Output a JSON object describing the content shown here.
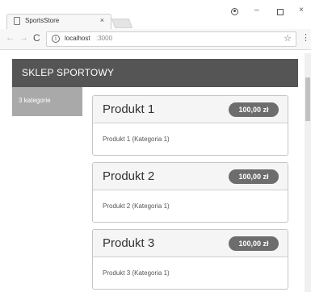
{
  "browser": {
    "tab_title": "SportsStore",
    "tab_close": "×",
    "url_host": "localhost",
    "url_port": ":3000",
    "window_min": "–",
    "window_close": "×",
    "back_glyph": "←",
    "forward_glyph": "→",
    "reload_glyph": "C",
    "info_glyph": "i",
    "star_glyph": "☆",
    "menu_glyph": "⋮"
  },
  "navbar": {
    "brand": "SKLEP SPORTOWY"
  },
  "categories": {
    "button_label": "3 kategorie"
  },
  "products": [
    {
      "name": "Produkt 1",
      "price": "100,00 zł",
      "description": "Produkt 1 (Kategoria 1)"
    },
    {
      "name": "Produkt 2",
      "price": "100,00 zł",
      "description": "Produkt 2 (Kategoria 1)"
    },
    {
      "name": "Produkt 3",
      "price": "100,00 zł",
      "description": "Produkt 3 (Kategoria 1)"
    }
  ],
  "colors": {
    "navbar_bg": "#555555",
    "category_button_bg": "#a9a9a9",
    "price_badge_bg": "#6d6d6d",
    "card_header_bg": "#f5f5f5"
  },
  "icons": [
    "page-icon",
    "info-icon",
    "star-icon",
    "menu-icon",
    "profile-icon"
  ]
}
